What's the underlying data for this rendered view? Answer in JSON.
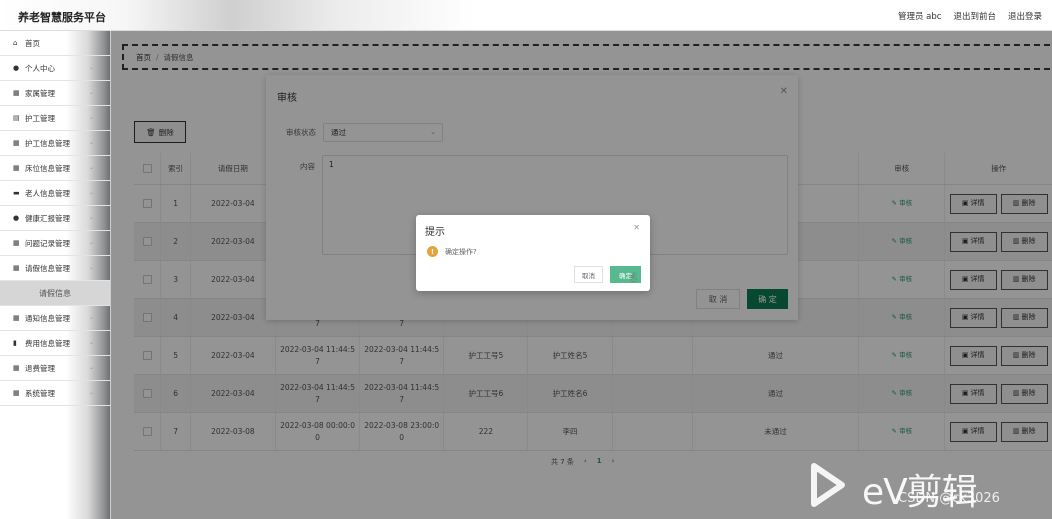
{
  "header": {
    "brand": "养老智慧服务平台",
    "links": [
      "管理员 abc",
      "退出到前台",
      "退出登录"
    ]
  },
  "sidebar": {
    "items": [
      {
        "icon": "home-icon",
        "label": "首页",
        "chevron": false
      },
      {
        "icon": "user-icon",
        "label": "个人中心",
        "chevron": true
      },
      {
        "icon": "grid-icon",
        "label": "家属管理",
        "chevron": true
      },
      {
        "icon": "doc-icon",
        "label": "护工管理",
        "chevron": true
      },
      {
        "icon": "grid-icon",
        "label": "护工信息管理",
        "chevron": true
      },
      {
        "icon": "grid-icon",
        "label": "床位信息管理",
        "chevron": true
      },
      {
        "icon": "car-icon",
        "label": "老人信息管理",
        "chevron": true
      },
      {
        "icon": "user-icon",
        "label": "健康汇报管理",
        "chevron": true
      },
      {
        "icon": "grid-icon",
        "label": "问题记录管理",
        "chevron": true
      },
      {
        "icon": "grid-icon",
        "label": "请假信息管理",
        "chevron": true
      }
    ],
    "active_sub": "请假信息",
    "items2": [
      {
        "icon": "grid-icon",
        "label": "通知信息管理",
        "chevron": true
      },
      {
        "icon": "chart-icon",
        "label": "费用信息管理",
        "chevron": true
      },
      {
        "icon": "grid-icon",
        "label": "退费管理",
        "chevron": true
      },
      {
        "icon": "grid-icon",
        "label": "系统管理",
        "chevron": true
      }
    ]
  },
  "breadcrumb": {
    "home": "首页",
    "sep": "/",
    "current": "请假信息"
  },
  "toolbar": {
    "delete_label": "删除"
  },
  "table": {
    "headers": {
      "index": "索引",
      "date": "请假日期",
      "audit": "审核",
      "op": "操作"
    },
    "rows": [
      {
        "index": "1",
        "date": "2022-03-04",
        "t1": "",
        "t2": "",
        "wno": "",
        "wname": "",
        "status": "",
        "audit": "审核"
      },
      {
        "index": "2",
        "date": "2022-03-04",
        "t1": "",
        "t2": "",
        "wno": "",
        "wname": "",
        "status": "",
        "audit": "审核"
      },
      {
        "index": "3",
        "date": "2022-03-04",
        "t1": "",
        "t2": "",
        "wno": "",
        "wname": "",
        "status": "",
        "audit": "审核"
      },
      {
        "index": "4",
        "date": "2022-03-04",
        "t1": "2022-03-04 11:44:5\n7",
        "t2": "2022-03-04 11:44:5\n7",
        "wno": "",
        "wname": "",
        "status": "",
        "audit": "审核"
      },
      {
        "index": "5",
        "date": "2022-03-04",
        "t1": "2022-03-04 11:44:5\n7",
        "t2": "2022-03-04 11:44:5\n7",
        "wno": "护工工号5",
        "wname": "护工姓名5",
        "status": "通过",
        "audit": "审核"
      },
      {
        "index": "6",
        "date": "2022-03-04",
        "t1": "2022-03-04 11:44:5\n7",
        "t2": "2022-03-04 11:44:5\n7",
        "wno": "护工工号6",
        "wname": "护工姓名6",
        "status": "通过",
        "audit": "审核"
      },
      {
        "index": "7",
        "date": "2022-03-08",
        "t1": "2022-03-08 00:00:0\n0",
        "t2": "2022-03-08 23:00:0\n0",
        "wno": "222",
        "wname": "李四",
        "status": "未通过",
        "audit": "审核"
      }
    ],
    "detail_label": "详情",
    "delete_label": "删除"
  },
  "pager": {
    "total": "共 7 条",
    "prev": "‹",
    "current": "1",
    "next": "›"
  },
  "dialog": {
    "title": "审核",
    "status_label": "审核状态",
    "status_value": "通过",
    "content_label": "内容",
    "content_value": "1",
    "cancel": "取 消",
    "confirm": "确 定"
  },
  "confirm_box": {
    "title": "提示",
    "message": "确定操作?",
    "cancel": "取消",
    "ok": "确定"
  },
  "watermark": {
    "brand": "eV剪辑",
    "csdn": "CSDN @ck3026"
  }
}
